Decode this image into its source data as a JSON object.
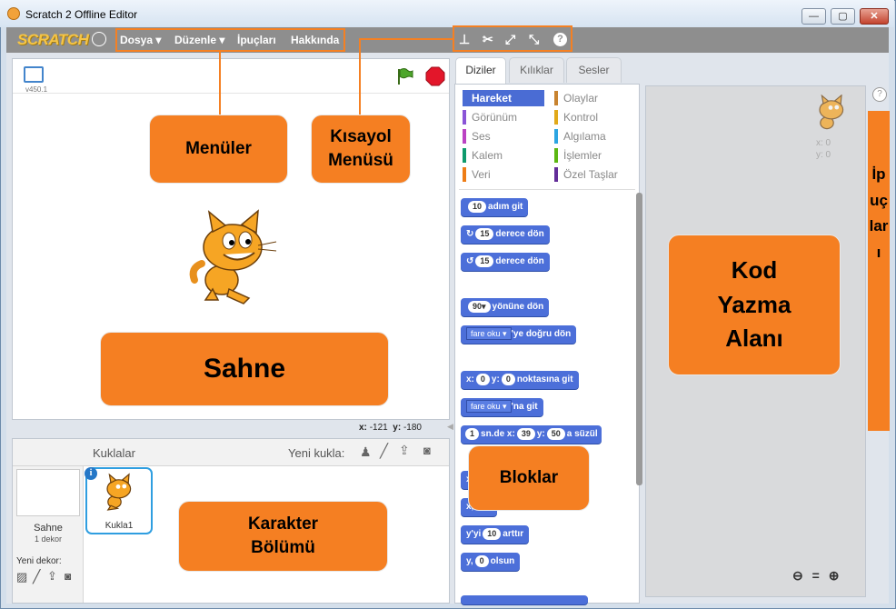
{
  "window": {
    "title": "Scratch 2 Offline Editor",
    "minimize": "—",
    "maximize": "▢",
    "close": "✕"
  },
  "menubar": {
    "logo": "SCRATCH",
    "items": [
      "Dosya ▾",
      "Düzenle ▾",
      "İpuçları",
      "Hakkında"
    ]
  },
  "stage": {
    "version": "v450.1",
    "coords": {
      "x_label": "x:",
      "x_value": "-121",
      "y_label": "y:",
      "y_value": "-180"
    }
  },
  "callouts": {
    "menuler": "Menüler",
    "kisayol_line1": "Kısayol",
    "kisayol_line2": "Menüsü",
    "sahne": "Sahne",
    "karakter_line1": "Karakter",
    "karakter_line2": "Bölümü",
    "bloklar": "Bloklar",
    "kod_line1": "Kod",
    "kod_line2": "Yazma",
    "kod_line3": "Alanı",
    "ipuclari_vertical": "İpuçları"
  },
  "sprites_panel": {
    "header": "Kuklalar",
    "new_sprite": "Yeni kukla:",
    "stage_label": "Sahne",
    "stage_backdrops": "1 dekor",
    "new_backdrop": "Yeni dekor:",
    "sprite_name": "Kukla1",
    "info": "i"
  },
  "tabs": [
    "Diziler",
    "Kılıklar",
    "Sesler"
  ],
  "categories": {
    "left": [
      {
        "label": "Hareket",
        "color": "#4a6cd4"
      },
      {
        "label": "Görünüm",
        "color": "#8a55d7"
      },
      {
        "label": "Ses",
        "color": "#bb42c3"
      },
      {
        "label": "Kalem",
        "color": "#0e9a6c"
      },
      {
        "label": "Veri",
        "color": "#ee7d16"
      }
    ],
    "right": [
      {
        "label": "Olaylar",
        "color": "#c88330"
      },
      {
        "label": "Kontrol",
        "color": "#e1a91a"
      },
      {
        "label": "Algılama",
        "color": "#2ca5e2"
      },
      {
        "label": "İşlemler",
        "color": "#5cb712"
      },
      {
        "label": "Özel Taşlar",
        "color": "#632d99"
      }
    ]
  },
  "blocks": {
    "move": {
      "value": "10",
      "text": "adım git"
    },
    "turn_right": {
      "value": "15",
      "text": "derece dön"
    },
    "turn_left": {
      "value": "15",
      "text": "derece dön"
    },
    "point_dir": {
      "value": "90▾",
      "text": "yönüne dön"
    },
    "point_towards": {
      "dropdown": "fare oku ▾",
      "text": "'ye doğru dön"
    },
    "goto_xy": {
      "x_label": "x:",
      "x": "0",
      "y_label": "y:",
      "y": "0",
      "text": "noktasına git"
    },
    "goto": {
      "dropdown": "fare oku ▾",
      "text": "'na git"
    },
    "glide": {
      "secs": "1",
      "secs_label": "sn.de x:",
      "x": "39",
      "y_label": "y:",
      "y": "50",
      "text": "a süzül"
    },
    "change_x_prefix": "x",
    "set_x_prefix": "x,",
    "change_y": {
      "prefix": "y'yi",
      "value": "10",
      "text": "arttır"
    },
    "set_y": {
      "prefix": "y,",
      "value": "0",
      "text": "olsun"
    }
  },
  "scripts_area": {
    "sprite_x": "x: 0",
    "sprite_y": "y: 0",
    "zoom_out": "⊖",
    "zoom_reset": "=",
    "zoom_in": "⊕"
  },
  "tips_button": "?"
}
